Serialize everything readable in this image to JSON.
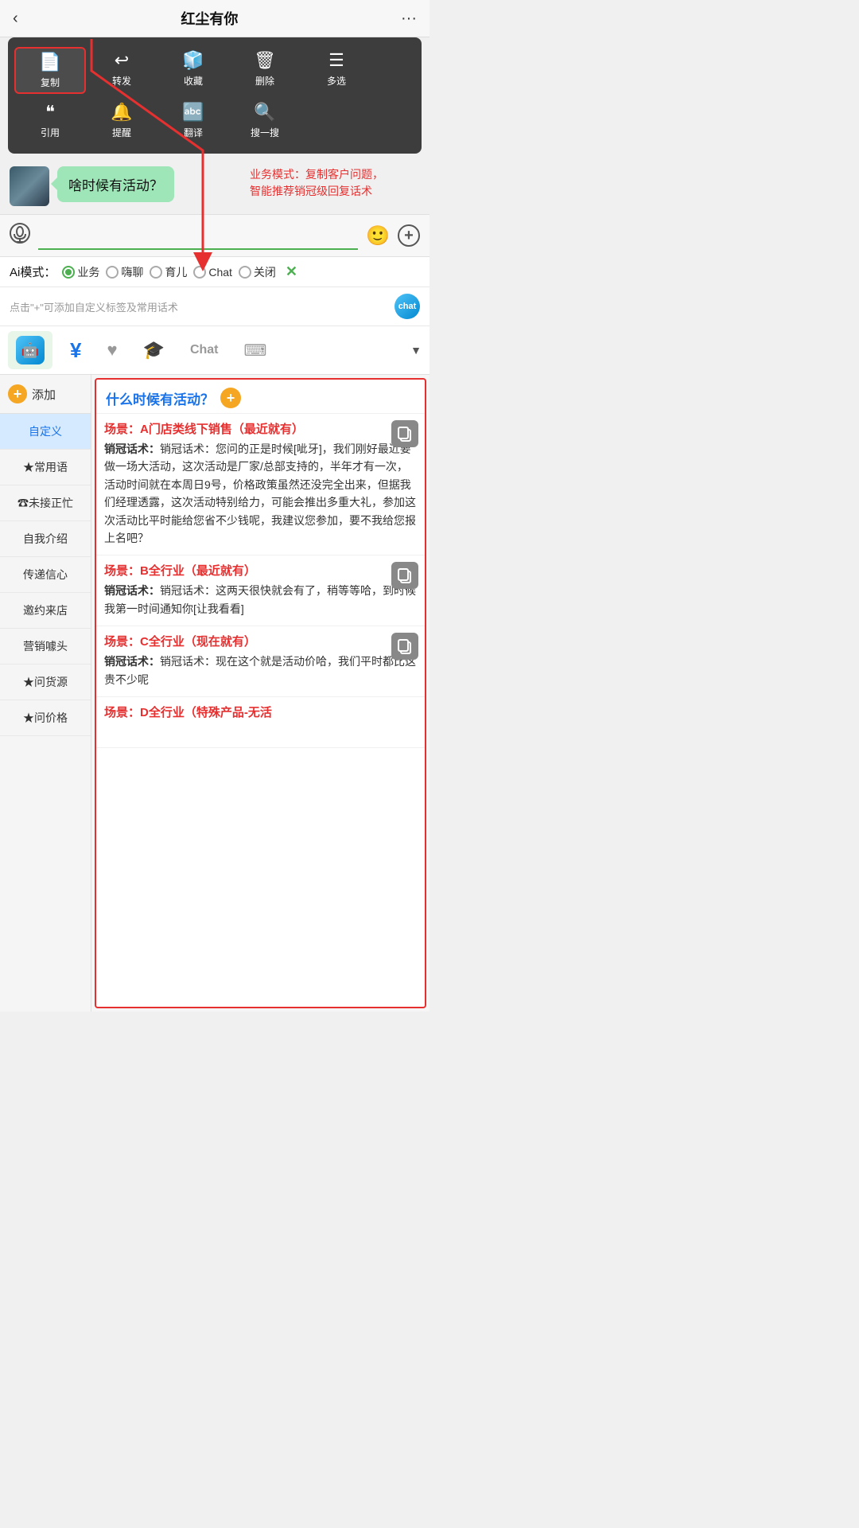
{
  "topBar": {
    "title": "红尘有你",
    "backIcon": "‹",
    "moreIcon": "···"
  },
  "contextMenu": {
    "row1": [
      {
        "icon": "📄",
        "label": "复制",
        "highlighted": true
      },
      {
        "icon": "↩",
        "label": "转发",
        "highlighted": false
      },
      {
        "icon": "🧊",
        "label": "收藏",
        "highlighted": false
      },
      {
        "icon": "🗑",
        "label": "删除",
        "highlighted": false
      },
      {
        "icon": "☰",
        "label": "多选",
        "highlighted": false
      }
    ],
    "row2": [
      {
        "icon": "❝",
        "label": "引用",
        "highlighted": false
      },
      {
        "icon": "🔔",
        "label": "提醒",
        "highlighted": false
      },
      {
        "icon": "🔤",
        "label": "翻译",
        "highlighted": false
      },
      {
        "icon": "🔍",
        "label": "搜一搜",
        "highlighted": false
      }
    ]
  },
  "chatMessage": {
    "bubbleText": "啥时候有活动？"
  },
  "annotation": {
    "text": "业务模式：复制客户问题，\n智能推荐销冠级回复话术"
  },
  "inputArea": {
    "placeholder": "",
    "voiceIcon": "voice",
    "emojiIcon": "emoji",
    "plusIcon": "plus"
  },
  "aiModeBar": {
    "label": "Ai模式：",
    "options": [
      {
        "label": "业务",
        "active": true
      },
      {
        "label": "嗨聊",
        "active": false
      },
      {
        "label": "育儿",
        "active": false
      },
      {
        "label": "Chat",
        "active": false
      },
      {
        "label": "关闭",
        "active": false
      }
    ],
    "closeLabel": "✕"
  },
  "hintBar": {
    "text": "点击\"+\"可添加自定义标签及常用话术"
  },
  "tabBar": {
    "tabs": [
      {
        "icon": "robot",
        "label": "chat",
        "active": true
      },
      {
        "icon": "¥",
        "label": "money",
        "active": false
      },
      {
        "icon": "♥",
        "label": "heart",
        "active": false
      },
      {
        "icon": "🎓",
        "label": "hat",
        "active": false
      },
      {
        "icon": "Chat",
        "label": "chat-text",
        "active": false
      },
      {
        "icon": "⌨",
        "label": "keyboard",
        "active": false
      }
    ],
    "arrowIcon": "▼"
  },
  "sidebar": {
    "addLabel": "添加",
    "items": [
      {
        "label": "自定义",
        "active": true
      },
      {
        "label": "★常用语",
        "active": false
      },
      {
        "label": "☎未接正忙",
        "active": false
      },
      {
        "label": "自我介绍",
        "active": false
      },
      {
        "label": "传递信心",
        "active": false
      },
      {
        "label": "邀约来店",
        "active": false
      },
      {
        "label": "营销噱头",
        "active": false
      },
      {
        "label": "★问货源",
        "active": false
      },
      {
        "label": "★问价格",
        "active": false
      }
    ]
  },
  "contentPanel": {
    "questionTitle": "什么时候有活动？",
    "scenarios": [
      {
        "scenarioLabel": "场景：A门店类线下销售（最近就有）",
        "salesScript": "销冠话术：您问的正是时候[呲牙]，我们刚好最近要做一场大活动，这次活动是厂家/总部支持的，半年才有一次，活动时间就在本周日9号，价格政策虽然还没完全出来，但据我们经理透露，这次活动特别给力，可能会推出多重大礼，参加这次活动比平时能给您省不少钱呢，我建议您参加，要不我给您报上名吧？"
      },
      {
        "scenarioLabel": "场景：B全行业（最近就有）",
        "salesScript": "销冠话术：这两天很快就会有了，稍等等哈，到时候我第一时间通知你[让我看看]"
      },
      {
        "scenarioLabel": "场景：C全行业（现在就有）",
        "salesScript": "销冠话术：现在这个就是活动价哈，我们平时都比这贵不少呢"
      },
      {
        "scenarioLabel": "场景：D全行业（特殊产品-无活",
        "salesScript": ""
      }
    ]
  },
  "arrowAnnotation": {
    "arrowLabel": "红色箭头指向复制按钮"
  }
}
